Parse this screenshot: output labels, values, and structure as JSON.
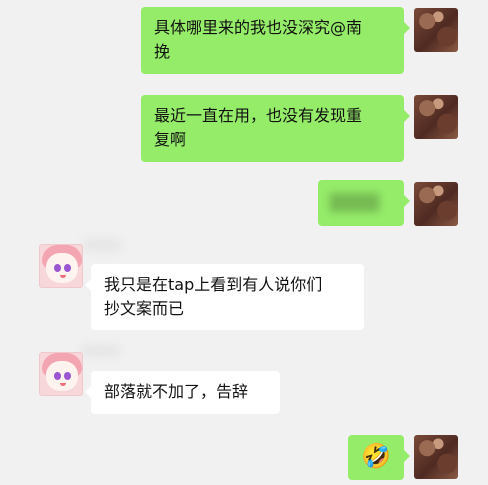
{
  "messages": [
    {
      "sender": "self",
      "text": "具体哪里来的我也没深究@南\n挽"
    },
    {
      "sender": "self",
      "text": "最近一直在用，也没有发现重\n复啊"
    },
    {
      "sender": "self",
      "text": "▒▒▒▒"
    },
    {
      "sender": "other",
      "text": "我只是在tap上看到有人说你们\n抄文案而已"
    },
    {
      "sender": "other",
      "text": "部落就不加了，告辞"
    },
    {
      "sender": "self",
      "text": "🤣"
    }
  ]
}
